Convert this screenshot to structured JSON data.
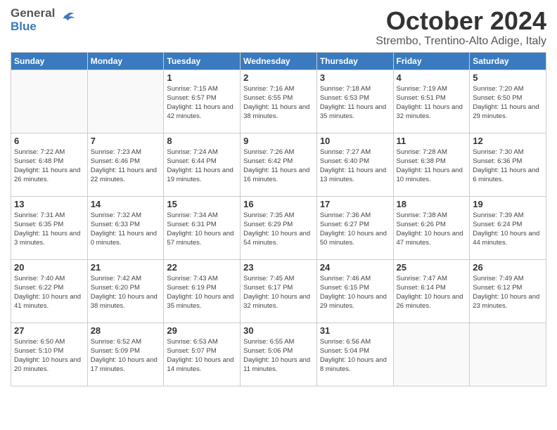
{
  "header": {
    "logo_general": "General",
    "logo_blue": "Blue",
    "month": "October 2024",
    "location": "Strembo, Trentino-Alto Adige, Italy"
  },
  "weekdays": [
    "Sunday",
    "Monday",
    "Tuesday",
    "Wednesday",
    "Thursday",
    "Friday",
    "Saturday"
  ],
  "weeks": [
    [
      {
        "day": "",
        "info": ""
      },
      {
        "day": "",
        "info": ""
      },
      {
        "day": "1",
        "info": "Sunrise: 7:15 AM\nSunset: 6:57 PM\nDaylight: 11 hours and 42 minutes."
      },
      {
        "day": "2",
        "info": "Sunrise: 7:16 AM\nSunset: 6:55 PM\nDaylight: 11 hours and 38 minutes."
      },
      {
        "day": "3",
        "info": "Sunrise: 7:18 AM\nSunset: 6:53 PM\nDaylight: 11 hours and 35 minutes."
      },
      {
        "day": "4",
        "info": "Sunrise: 7:19 AM\nSunset: 6:51 PM\nDaylight: 11 hours and 32 minutes."
      },
      {
        "day": "5",
        "info": "Sunrise: 7:20 AM\nSunset: 6:50 PM\nDaylight: 11 hours and 29 minutes."
      }
    ],
    [
      {
        "day": "6",
        "info": "Sunrise: 7:22 AM\nSunset: 6:48 PM\nDaylight: 11 hours and 26 minutes."
      },
      {
        "day": "7",
        "info": "Sunrise: 7:23 AM\nSunset: 6:46 PM\nDaylight: 11 hours and 22 minutes."
      },
      {
        "day": "8",
        "info": "Sunrise: 7:24 AM\nSunset: 6:44 PM\nDaylight: 11 hours and 19 minutes."
      },
      {
        "day": "9",
        "info": "Sunrise: 7:26 AM\nSunset: 6:42 PM\nDaylight: 11 hours and 16 minutes."
      },
      {
        "day": "10",
        "info": "Sunrise: 7:27 AM\nSunset: 6:40 PM\nDaylight: 11 hours and 13 minutes."
      },
      {
        "day": "11",
        "info": "Sunrise: 7:28 AM\nSunset: 6:38 PM\nDaylight: 11 hours and 10 minutes."
      },
      {
        "day": "12",
        "info": "Sunrise: 7:30 AM\nSunset: 6:36 PM\nDaylight: 11 hours and 6 minutes."
      }
    ],
    [
      {
        "day": "13",
        "info": "Sunrise: 7:31 AM\nSunset: 6:35 PM\nDaylight: 11 hours and 3 minutes."
      },
      {
        "day": "14",
        "info": "Sunrise: 7:32 AM\nSunset: 6:33 PM\nDaylight: 11 hours and 0 minutes."
      },
      {
        "day": "15",
        "info": "Sunrise: 7:34 AM\nSunset: 6:31 PM\nDaylight: 10 hours and 57 minutes."
      },
      {
        "day": "16",
        "info": "Sunrise: 7:35 AM\nSunset: 6:29 PM\nDaylight: 10 hours and 54 minutes."
      },
      {
        "day": "17",
        "info": "Sunrise: 7:36 AM\nSunset: 6:27 PM\nDaylight: 10 hours and 50 minutes."
      },
      {
        "day": "18",
        "info": "Sunrise: 7:38 AM\nSunset: 6:26 PM\nDaylight: 10 hours and 47 minutes."
      },
      {
        "day": "19",
        "info": "Sunrise: 7:39 AM\nSunset: 6:24 PM\nDaylight: 10 hours and 44 minutes."
      }
    ],
    [
      {
        "day": "20",
        "info": "Sunrise: 7:40 AM\nSunset: 6:22 PM\nDaylight: 10 hours and 41 minutes."
      },
      {
        "day": "21",
        "info": "Sunrise: 7:42 AM\nSunset: 6:20 PM\nDaylight: 10 hours and 38 minutes."
      },
      {
        "day": "22",
        "info": "Sunrise: 7:43 AM\nSunset: 6:19 PM\nDaylight: 10 hours and 35 minutes."
      },
      {
        "day": "23",
        "info": "Sunrise: 7:45 AM\nSunset: 6:17 PM\nDaylight: 10 hours and 32 minutes."
      },
      {
        "day": "24",
        "info": "Sunrise: 7:46 AM\nSunset: 6:15 PM\nDaylight: 10 hours and 29 minutes."
      },
      {
        "day": "25",
        "info": "Sunrise: 7:47 AM\nSunset: 6:14 PM\nDaylight: 10 hours and 26 minutes."
      },
      {
        "day": "26",
        "info": "Sunrise: 7:49 AM\nSunset: 6:12 PM\nDaylight: 10 hours and 23 minutes."
      }
    ],
    [
      {
        "day": "27",
        "info": "Sunrise: 6:50 AM\nSunset: 5:10 PM\nDaylight: 10 hours and 20 minutes."
      },
      {
        "day": "28",
        "info": "Sunrise: 6:52 AM\nSunset: 5:09 PM\nDaylight: 10 hours and 17 minutes."
      },
      {
        "day": "29",
        "info": "Sunrise: 6:53 AM\nSunset: 5:07 PM\nDaylight: 10 hours and 14 minutes."
      },
      {
        "day": "30",
        "info": "Sunrise: 6:55 AM\nSunset: 5:06 PM\nDaylight: 10 hours and 11 minutes."
      },
      {
        "day": "31",
        "info": "Sunrise: 6:56 AM\nSunset: 5:04 PM\nDaylight: 10 hours and 8 minutes."
      },
      {
        "day": "",
        "info": ""
      },
      {
        "day": "",
        "info": ""
      }
    ]
  ]
}
